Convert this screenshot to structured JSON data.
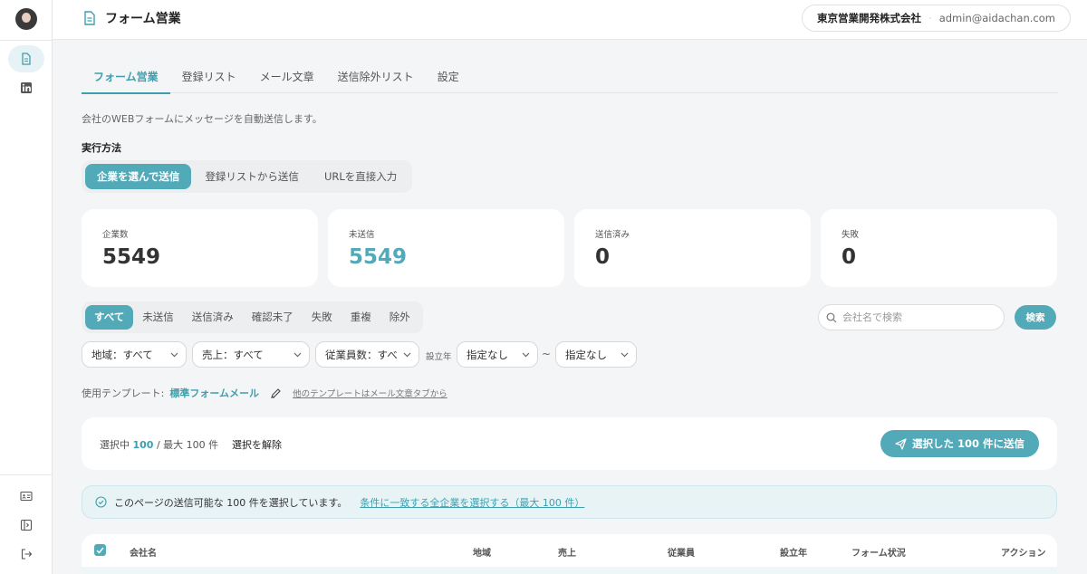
{
  "header": {
    "title": "フォーム営業",
    "company": "東京営業開発株式会社",
    "separator": "·",
    "email": "admin@aidachan.com"
  },
  "tabs": [
    "フォーム営業",
    "登録リスト",
    "メール文章",
    "送信除外リスト",
    "設定"
  ],
  "description": "会社のWEBフォームにメッセージを自動送信します。",
  "method": {
    "label": "実行方法",
    "options": [
      "企業を選んで送信",
      "登録リストから送信",
      "URLを直接入力"
    ],
    "selected": "企業を選んで送信"
  },
  "stats": [
    {
      "label": "企業数",
      "value": "5549"
    },
    {
      "label": "未送信",
      "value": "5549"
    },
    {
      "label": "送信済み",
      "value": "0"
    },
    {
      "label": "失敗",
      "value": "0"
    }
  ],
  "status_filters": [
    "すべて",
    "未送信",
    "送信済み",
    "確認未了",
    "失敗",
    "重複",
    "除外"
  ],
  "search": {
    "placeholder": "会社名で検索",
    "button": "検索"
  },
  "dropdowns": {
    "region": "地域：すべて",
    "sales": "売上：すべて",
    "employees": "従業員数：すべて",
    "founded_label": "設立年",
    "founded_from": "指定なし",
    "tilde": "~",
    "founded_to": "指定なし"
  },
  "template": {
    "label": "使用テンプレート:",
    "name": "標準フォームメール",
    "hint": "他のテンプレートはメール文章タブから"
  },
  "selection": {
    "prefix": "選択中",
    "count": "100",
    "suffix": "/ 最大 100 件",
    "deselect": "選択を解除",
    "send_button": "選択した 100 件に送信"
  },
  "notice": {
    "text": "このページの送信可能な 100 件を選択しています。",
    "link": "条件に一致する全企業を選択する（最大 100 件）"
  },
  "table": {
    "columns": [
      "会社名",
      "地域",
      "売上",
      "従業員",
      "設立年",
      "フォーム状況",
      "アクション"
    ]
  },
  "colors": {
    "accent": "#52a9b7",
    "accent_text": "#3e9fae"
  }
}
